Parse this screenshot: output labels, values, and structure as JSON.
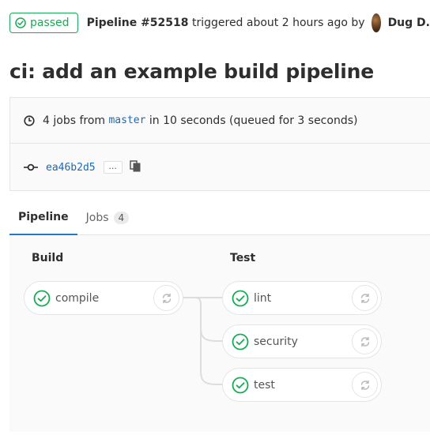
{
  "header": {
    "status_label": "passed",
    "pipeline_label": "Pipeline #52518",
    "triggered_text": "triggered about 2 hours ago by",
    "author": "Dug D."
  },
  "title": "ci: add an example build pipeline",
  "info": {
    "jobs_count_text": "4 jobs from",
    "branch": "master",
    "duration_text": "in 10 seconds (queued for 3 seconds)",
    "commit_sha": "ea46b2d5",
    "ellipsis": "..."
  },
  "tabs": [
    {
      "label": "Pipeline"
    },
    {
      "label": "Jobs",
      "count": "4"
    }
  ],
  "stages": [
    {
      "name": "Build",
      "jobs": [
        {
          "name": "compile",
          "status": "passed"
        }
      ]
    },
    {
      "name": "Test",
      "jobs": [
        {
          "name": "lint",
          "status": "passed"
        },
        {
          "name": "security",
          "status": "passed"
        },
        {
          "name": "test",
          "status": "passed"
        }
      ]
    }
  ],
  "colors": {
    "success": "#1aaa55",
    "link": "#1b69b6",
    "tab_active": "#1f78d1"
  },
  "icons": {
    "status": "check-circle-icon",
    "retry": "retry-icon",
    "clock": "clock-icon",
    "commit": "commit-icon",
    "copy": "copy-icon"
  }
}
